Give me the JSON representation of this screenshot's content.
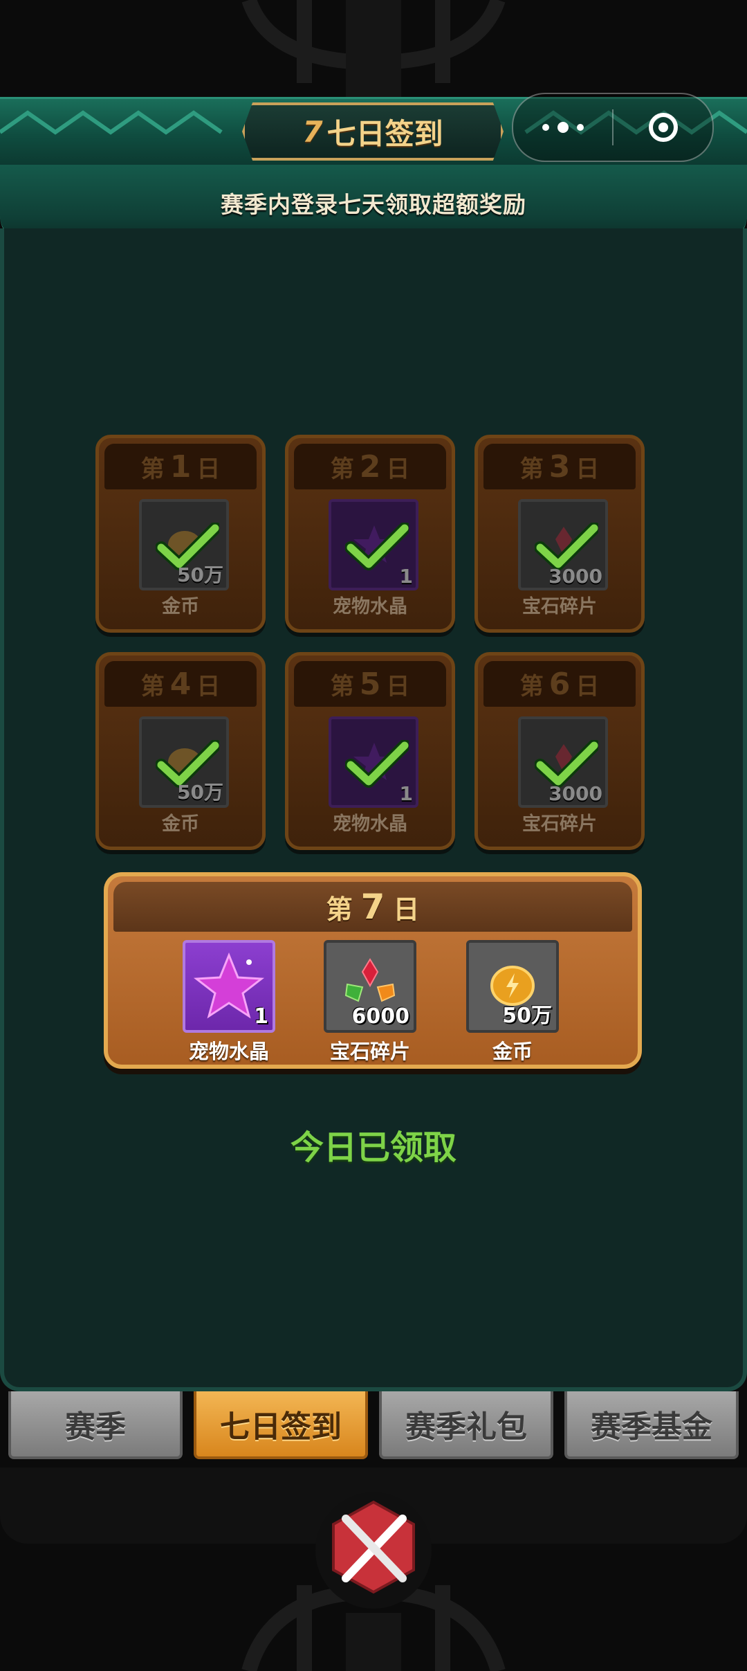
{
  "header": {
    "title_mark": "7",
    "title": "七日签到",
    "more_icon": "more-dots-icon",
    "close_icon": "target-close-icon"
  },
  "subheader": {
    "text": "赛季内登录七天领取超额奖励"
  },
  "days": [
    {
      "prefix": "第",
      "num": "1",
      "suffix": "日",
      "item": "金币",
      "qty": "50万",
      "icon": "coin-icon",
      "claimed": true
    },
    {
      "prefix": "第",
      "num": "2",
      "suffix": "日",
      "item": "宠物水晶",
      "qty": "1",
      "icon": "star-crystal-icon",
      "claimed": true
    },
    {
      "prefix": "第",
      "num": "3",
      "suffix": "日",
      "item": "宝石碎片",
      "qty": "3000",
      "icon": "gem-icon",
      "claimed": true
    },
    {
      "prefix": "第",
      "num": "4",
      "suffix": "日",
      "item": "金币",
      "qty": "50万",
      "icon": "coin-icon",
      "claimed": true
    },
    {
      "prefix": "第",
      "num": "5",
      "suffix": "日",
      "item": "宠物水晶",
      "qty": "1",
      "icon": "star-crystal-icon",
      "claimed": true
    },
    {
      "prefix": "第",
      "num": "6",
      "suffix": "日",
      "item": "宝石碎片",
      "qty": "3000",
      "icon": "gem-icon",
      "claimed": true
    }
  ],
  "day7": {
    "prefix": "第",
    "num": "7",
    "suffix": "日",
    "rewards": [
      {
        "label": "宠物水晶",
        "qty": "1",
        "icon": "star-crystal-icon"
      },
      {
        "label": "宝石碎片",
        "qty": "6000",
        "icon": "gem-shards-icon"
      },
      {
        "label": "金币",
        "qty": "50万",
        "icon": "coin-icon"
      }
    ]
  },
  "status": {
    "text": "今日已领取",
    "color": "#7ed348"
  },
  "tabs": [
    {
      "label": "赛季",
      "active": false
    },
    {
      "label": "七日签到",
      "active": true
    },
    {
      "label": "赛季礼包",
      "active": false
    },
    {
      "label": "赛季基金",
      "active": false
    }
  ],
  "colors": {
    "accent": "#e4a94f",
    "panel": "#102825",
    "ribbon": "#1a6e5a"
  }
}
